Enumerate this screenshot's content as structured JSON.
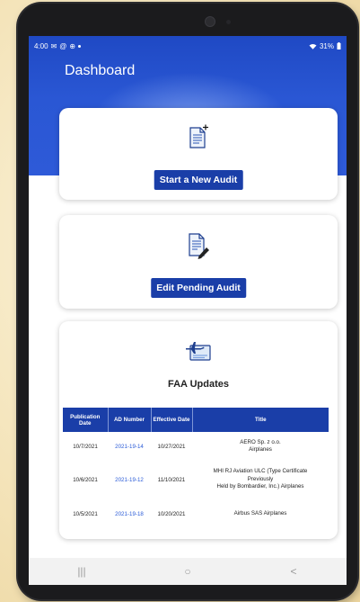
{
  "status_bar": {
    "time": "4:00",
    "notification_icons": [
      "mail-icon",
      "at-icon",
      "globe-icon",
      "dot-icon"
    ],
    "battery": "31%"
  },
  "header": {
    "title": "Dashboard",
    "colors": {
      "primary": "#1f49c4",
      "button": "#1a3ea8",
      "link": "#2a5bd7"
    }
  },
  "cards": {
    "new_audit": {
      "icon": "new-document-icon",
      "button_label": "Start a New Audit"
    },
    "edit_audit": {
      "icon": "edit-document-icon",
      "button_label": "Edit Pending Audit"
    },
    "faa": {
      "icon": "airplane-screen-icon",
      "heading": "FAA Updates",
      "columns": [
        "Publication Date",
        "AD Number",
        "Effective Date",
        "Title"
      ],
      "rows": [
        {
          "publication_date": "10/7/2021",
          "ad_number": "2021-19-14",
          "effective_date": "10/27/2021",
          "title_line1": "AERO Sp. z o.o.",
          "title_line2": "Airplanes",
          "title_line3": ""
        },
        {
          "publication_date": "10/6/2021",
          "ad_number": "2021-19-12",
          "effective_date": "11/10/2021",
          "title_line1": "MHI RJ Aviation ULC (Type Certificate",
          "title_line2": "Previously",
          "title_line3": "Held by Bombardier, Inc.) Airplanes"
        },
        {
          "publication_date": "10/5/2021",
          "ad_number": "2021-19-18",
          "effective_date": "10/20/2021",
          "title_line1": "Airbus SAS Airplanes",
          "title_line2": "",
          "title_line3": ""
        }
      ]
    }
  },
  "nav_bar": {
    "recents": "|||",
    "home": "○",
    "back": "<"
  }
}
